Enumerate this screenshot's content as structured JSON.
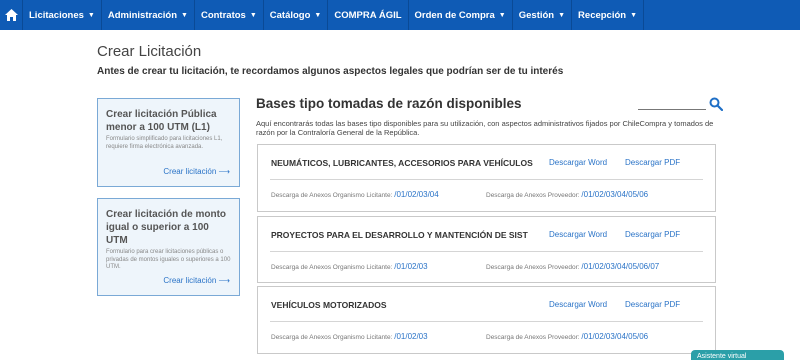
{
  "nav": {
    "items": [
      {
        "label": "Licitaciones",
        "caret": true
      },
      {
        "label": "Administración",
        "caret": true
      },
      {
        "label": "Contratos",
        "caret": true
      },
      {
        "label": "Catálogo",
        "caret": true
      },
      {
        "label": "COMPRA ÁGIL",
        "caret": false
      },
      {
        "label": "Orden de Compra",
        "caret": true
      },
      {
        "label": "Gestión",
        "caret": true
      },
      {
        "label": "Recepción",
        "caret": true
      }
    ],
    "caret_glyph": "▼"
  },
  "page": {
    "title": "Crear Licitación",
    "subtitle": "Antes de crear tu licitación, te recordamos algunos aspectos legales que podrían ser de tu interés"
  },
  "cards": [
    {
      "title": "Crear licitación Pública menor a 100 UTM (L1)",
      "desc": "Formulario simplificado para licitaciones L1, requiere firma electrónica avanzada.",
      "link": "Crear licitación ⟶"
    },
    {
      "title": "Crear licitación de monto igual o superior a 100 UTM",
      "desc": "Formulario para crear licitaciones públicas o privadas de montos iguales o superiores a 100 UTM.",
      "link": "Crear licitación ⟶"
    }
  ],
  "bases": {
    "title": "Bases tipo tomadas de razón disponibles",
    "description": "Aquí encontrarás todas las bases tipo disponibles para su utilización, con aspectos administrativos fijados por ChileCompra y tomados de razón por la Contraloría General de la República.",
    "search_placeholder": "",
    "items": [
      {
        "name": "NEUMÁTICOS, LUBRICANTES, ACCESORIOS PARA VEHÍCULOS",
        "word": "Descargar Word",
        "pdf": "Descargar PDF",
        "org_label": "Descarga de Anexos Organismo Licitante:",
        "org_links": "/01/02/03/04",
        "prov_label": "Descarga de Anexos Proveedor:",
        "prov_links": "/01/02/03/04/05/06"
      },
      {
        "name": "PROYECTOS PARA EL DESARROLLO Y MANTENCIÓN DE SIST",
        "word": "Descargar Word",
        "pdf": "Descargar PDF",
        "org_label": "Descarga de Anexos Organismo Licitante:",
        "org_links": "/01/02/03",
        "prov_label": "Descarga de Anexos Proveedor:",
        "prov_links": "/01/02/03/04/05/06/07"
      },
      {
        "name": "VEHÍCULOS MOTORIZADOS",
        "word": "Descargar Word",
        "pdf": "Descargar PDF",
        "org_label": "Descarga de Anexos Organismo Licitante:",
        "org_links": "/01/02/03",
        "prov_label": "Descarga de Anexos Proveedor:",
        "prov_links": "/01/02/03/04/05/06"
      }
    ]
  },
  "assistant": {
    "label": "Asistente virtual"
  },
  "colors": {
    "nav_bg": "#0f5bb5",
    "link": "#2a73c7",
    "card_bg": "#eef5fb",
    "assistant": "#2b9fa8"
  }
}
